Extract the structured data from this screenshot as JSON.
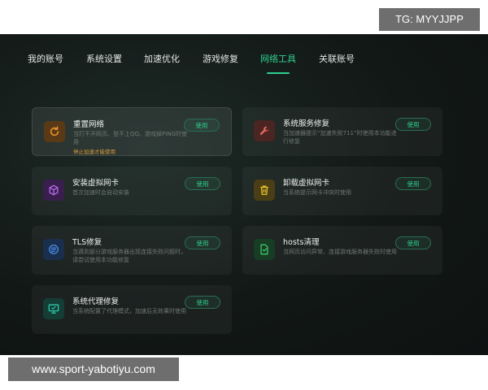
{
  "overlays": {
    "tg_label": "TG: MYYJJPP",
    "website": "www.sport-yabotiyu.com"
  },
  "tabs": [
    {
      "label": "我的账号",
      "active": false
    },
    {
      "label": "系统设置",
      "active": false
    },
    {
      "label": "加速优化",
      "active": false
    },
    {
      "label": "游戏修复",
      "active": false
    },
    {
      "label": "网络工具",
      "active": true
    },
    {
      "label": "关联账号",
      "active": false
    }
  ],
  "colors": {
    "accent": "#2fd08e",
    "warning": "#d89a3a"
  },
  "tools": [
    {
      "title": "重置网络",
      "desc": "当打不开网页、登不上QQ、游戏掉PING时使用",
      "warning": "停止加速才能使用",
      "button": "使用",
      "icon": "refresh-icon",
      "icon_color": "#e8922e",
      "icon_bg": "#5a3a16"
    },
    {
      "title": "系统服务修复",
      "desc": "当加速器提示“加速失败711”时使用本功能进行修复",
      "button": "使用",
      "icon": "wrench-icon",
      "icon_color": "#e26a5c",
      "icon_bg": "#4a2522"
    },
    {
      "title": "安装虚拟网卡",
      "desc": "首次加速时会自动安装",
      "button": "使用",
      "icon": "cube-icon",
      "icon_color": "#b56ae8",
      "icon_bg": "#3a1f4e"
    },
    {
      "title": "卸载虚拟网卡",
      "desc": "当系统提示网卡冲突时使用",
      "button": "使用",
      "icon": "trash-icon",
      "icon_color": "#e8c12e",
      "icon_bg": "#4a3e16"
    },
    {
      "title": "TLS修复",
      "desc": "当遇到部分游戏服务器出现连接失败问题时，请尝试使用本功能修复",
      "button": "使用",
      "icon": "tls-icon",
      "icon_color": "#4a8fe8",
      "icon_bg": "#1a2e4e"
    },
    {
      "title": "hosts清理",
      "desc": "当网页访问异常、连接游戏服务器失败时使用",
      "button": "使用",
      "icon": "file-clean-icon",
      "icon_color": "#3ec46a",
      "icon_bg": "#173d24"
    },
    {
      "title": "系统代理修复",
      "desc": "当系统配置了代理模式，加速后无效果时使用",
      "button": "使用",
      "icon": "monitor-icon",
      "icon_color": "#2fc9a8",
      "icon_bg": "#143d36"
    }
  ]
}
